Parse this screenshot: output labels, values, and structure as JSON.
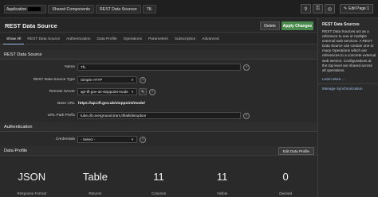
{
  "breadcrumb": [
    "Application",
    "Shared Components",
    "REST Data Sources",
    "TfL"
  ],
  "toolbar": {
    "edit_page_label": "Edit Page 1"
  },
  "header": {
    "title": "REST Data Source",
    "delete_label": "Delete",
    "apply_label": "Apply Changes"
  },
  "tabs": [
    "Show All",
    "REST Data Source",
    "Authentication",
    "Data Profile",
    "Operations",
    "Parameters",
    "Subscription",
    "Advanced"
  ],
  "sections": {
    "rest": "REST Data Source",
    "auth": "Authentication",
    "profile": "Data Profile"
  },
  "form": {
    "name_label": "Name",
    "name_value": "TfL",
    "type_label": "REST Data Source Type",
    "type_value": "Simple HTTP",
    "server_label": "Remote Server",
    "server_value": "api-tfl-gov-uk-stoppoint-mode",
    "base_label": "Base URL",
    "base_value": "https://api.tfl.gov.uk/stoppoint/mode/",
    "prefix_label": "URL Path Prefix",
    "prefix_value": "tube,dlr,overground,tram,tflrail/disruption",
    "cred_label": "Credentials",
    "cred_value": "- Select -"
  },
  "profile": {
    "edit_label": "Edit Data Profile",
    "stats": [
      {
        "value": "JSON",
        "label": "Response Format"
      },
      {
        "value": "Table",
        "label": "Returns"
      },
      {
        "value": "11",
        "label": "Columns"
      },
      {
        "value": "11",
        "label": "Visible"
      },
      {
        "value": "0",
        "label": "Derived"
      }
    ]
  },
  "sidebar": {
    "heading": "REST Data Sources",
    "text": "REST Data Sources act as a reference to one or multiple external web services. A REST Data Source can contain one or many Operations which are references to a concrete external web service. Configurations at the top level are shared across all operations.",
    "learn_more": "Learn More ...",
    "manage_sync": "Manage Synchronization"
  }
}
